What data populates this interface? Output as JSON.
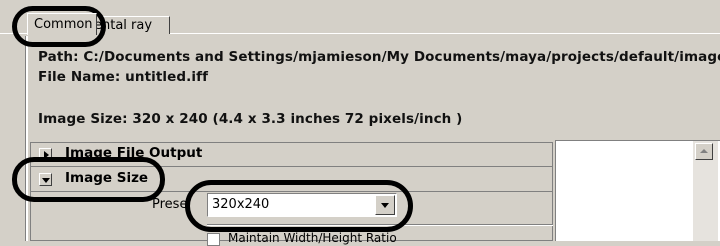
{
  "tabs": [
    {
      "label": "Common",
      "active": true
    },
    {
      "label": "ental ray",
      "active": false
    }
  ],
  "info": {
    "path": "Path: C:/Documents and Settings/mjamieson/My Documents/maya/projects/default/images/",
    "file_name": "File Name:  untitled.iff",
    "image_size": "Image Size: 320 x 240 (4.4 x 3.3 inches 72 pixels/inch )"
  },
  "sections": {
    "image_file_output": {
      "label": "Image File Output",
      "expanded": false
    },
    "image_size": {
      "label": "Image Size",
      "expanded": true
    }
  },
  "preset": {
    "label": "Prese",
    "value": "320x240"
  },
  "maintain_ratio": {
    "label": "Maintain Width/Height Ratio",
    "checked": false
  },
  "colors": {
    "panel_bg": "#d4d0c8",
    "annotation": "#000000"
  }
}
